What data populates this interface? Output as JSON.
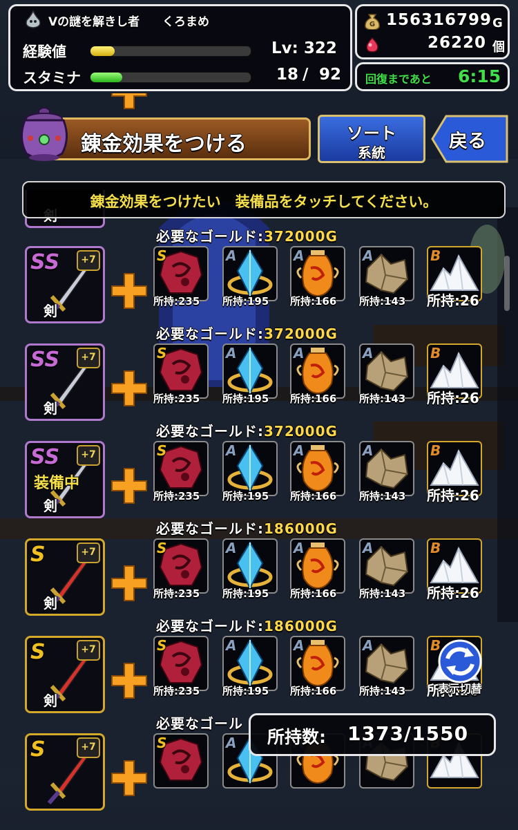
{
  "status": {
    "title": "Vの謎を解きし者",
    "name": "くろまめ",
    "exp_label": "経験値",
    "level": "Lv: 322",
    "stamina_label": "スタミナ",
    "stamina_current": "18",
    "stamina_sep": "/",
    "stamina_max": "92",
    "exp_fraction": 0.15,
    "stamina_fraction": 0.2
  },
  "wallet": {
    "gold": "156316799",
    "gold_unit": "G",
    "gems": "26220",
    "gem_unit": "個"
  },
  "recovery": {
    "label": "回復まであと",
    "time": "6:15"
  },
  "header": {
    "title": "錬金効果をつける",
    "sort_label": "ソート",
    "sort_sub": "系統",
    "back_label": "戻る"
  },
  "instruction": "錬金効果をつけたい　装備品をタッチしてください。",
  "gold_label": "必要なゴールド:",
  "rows": [
    {
      "rank": "SS",
      "plus": "+7",
      "type": "剣",
      "equipped": "",
      "gold": "372000G"
    },
    {
      "rank": "SS",
      "plus": "+7",
      "type": "剣",
      "equipped": "",
      "gold": "372000G"
    },
    {
      "rank": "SS",
      "plus": "+7",
      "type": "剣",
      "equipped": "装備中",
      "gold": "372000G"
    },
    {
      "rank": "S",
      "plus": "+7",
      "type": "剣",
      "equipped": "",
      "gold": "186000G"
    },
    {
      "rank": "S",
      "plus": "+7",
      "type": "剣",
      "equipped": "",
      "gold": "186000G"
    },
    {
      "rank": "S",
      "plus": "+7",
      "type": "",
      "equipped": "",
      "gold": ""
    }
  ],
  "partial_top": {
    "type": "剣"
  },
  "partial_gold": "必要なゴール",
  "materials": [
    {
      "rank": "S",
      "own": "所持:235",
      "icon": "red-orb-icon"
    },
    {
      "rank": "A",
      "own": "所持:195",
      "icon": "blue-crystal-icon"
    },
    {
      "rank": "A",
      "own": "所持:166",
      "icon": "orange-vase-icon"
    },
    {
      "rank": "A",
      "own": "所持:143",
      "icon": "rock-icon"
    },
    {
      "rank": "B",
      "own": "所持:26",
      "icon": "white-salt-icon"
    }
  ],
  "toggle_label": "表示切替",
  "possess": {
    "label": "所持数:",
    "value": "1373/1550"
  },
  "colors": {
    "ss_rank": "#c86ad6",
    "s_rank": "#f0c020",
    "a_rank": "#8aa0c0",
    "b_rank": "#e08a2a",
    "accent_green": "#3fe04a"
  }
}
